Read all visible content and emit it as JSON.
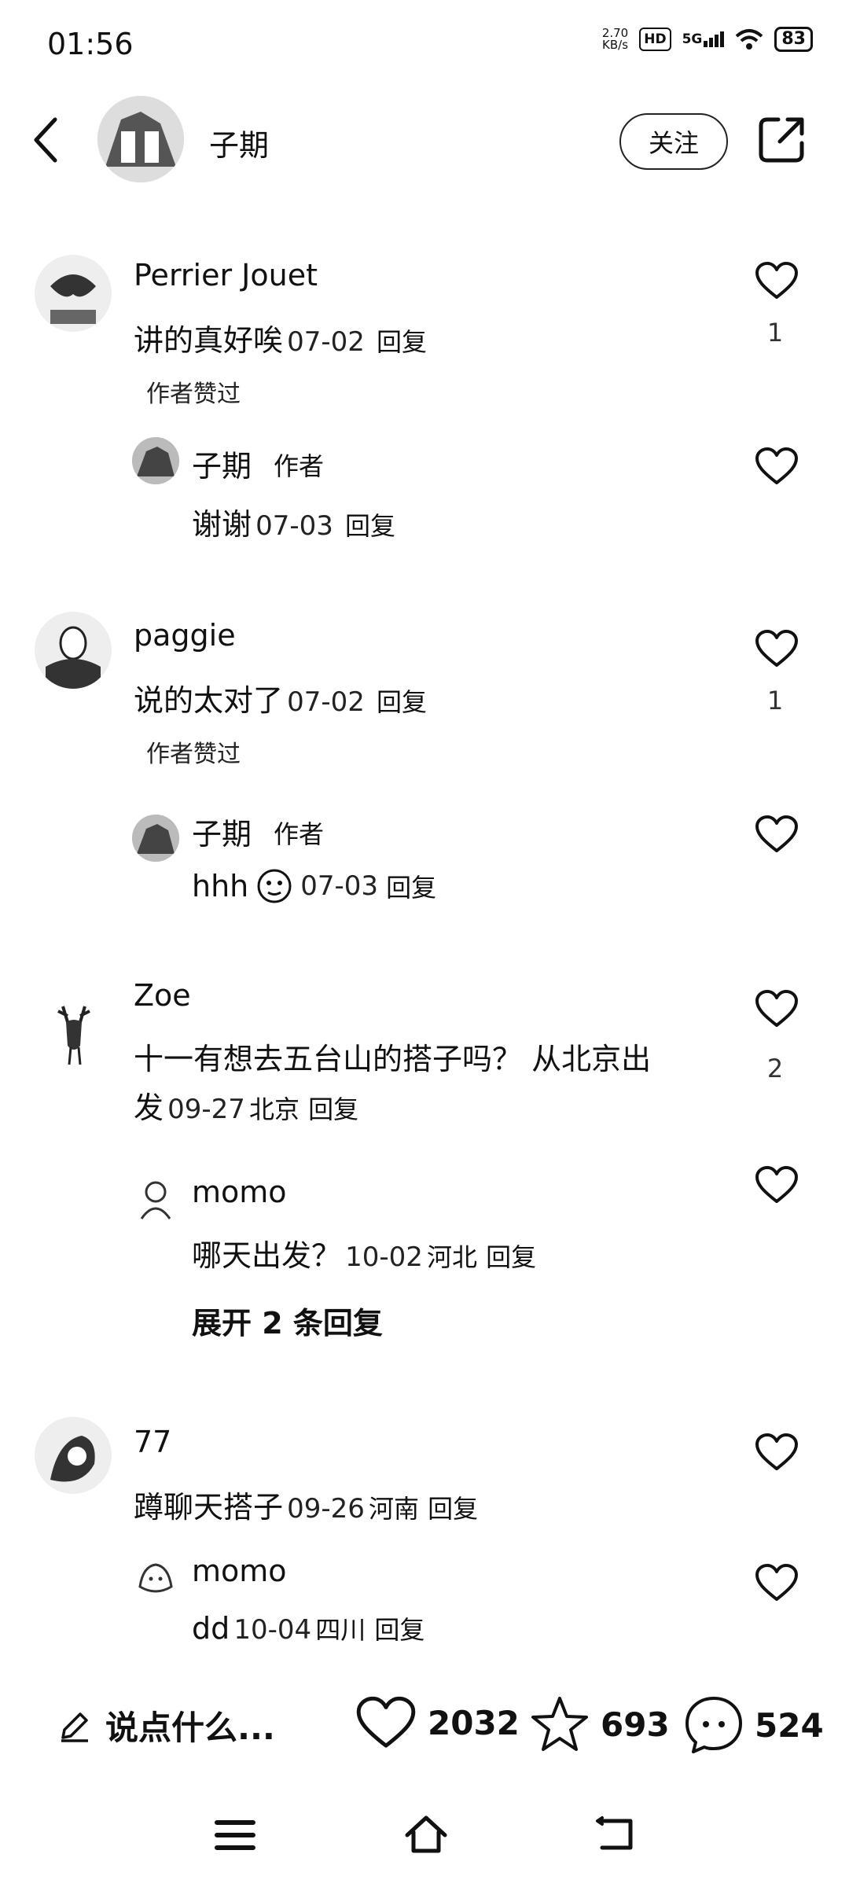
{
  "status_bar": {
    "time": "01:56",
    "speed_value": "2.70",
    "speed_unit": "KB/s",
    "hd": "HD",
    "network": "5G",
    "battery": "83"
  },
  "header": {
    "title": "子期",
    "follow_label": "关注"
  },
  "comments": [
    {
      "user": "Perrier Jouet",
      "text": "讲的真好唉",
      "date": "07-02",
      "reply": "回复",
      "likes": "1",
      "author_liked": "作者赞过",
      "reply_item": {
        "user": "子期",
        "badge": "作者",
        "text": "谢谢",
        "date": "07-03",
        "reply": "回复"
      }
    },
    {
      "user": "paggie",
      "text": "说的太对了",
      "date": "07-02",
      "reply": "回复",
      "likes": "1",
      "author_liked": "作者赞过",
      "reply_item": {
        "user": "子期",
        "badge": "作者",
        "text": "hhh",
        "date": "07-03",
        "reply": "回复"
      }
    },
    {
      "user": "Zoe",
      "text_line1": "十一有想去五台山的搭子吗？ 从北京出",
      "text_line2": "发",
      "date": "09-27",
      "location": "北京",
      "reply": "回复",
      "likes": "2",
      "reply_item": {
        "user": "momo",
        "text": "哪天出发？",
        "date": "10-02",
        "location": "河北",
        "reply": "回复"
      },
      "expand": "展开 2 条回复"
    },
    {
      "user": "77",
      "text": "蹲聊天搭子",
      "date": "09-26",
      "location": "河南",
      "reply": "回复",
      "reply_item": {
        "user": "momo",
        "text": "dd",
        "date": "10-04",
        "location": "四川",
        "reply": "回复"
      }
    }
  ],
  "bottom_bar": {
    "input_placeholder": "说点什么...",
    "likes": "2032",
    "favorites": "693",
    "comments": "524"
  },
  "icons": [
    "back-icon",
    "share-icon",
    "heart-icon",
    "pencil-icon",
    "star-icon",
    "chat-icon",
    "menu-icon",
    "home-icon",
    "return-icon"
  ]
}
